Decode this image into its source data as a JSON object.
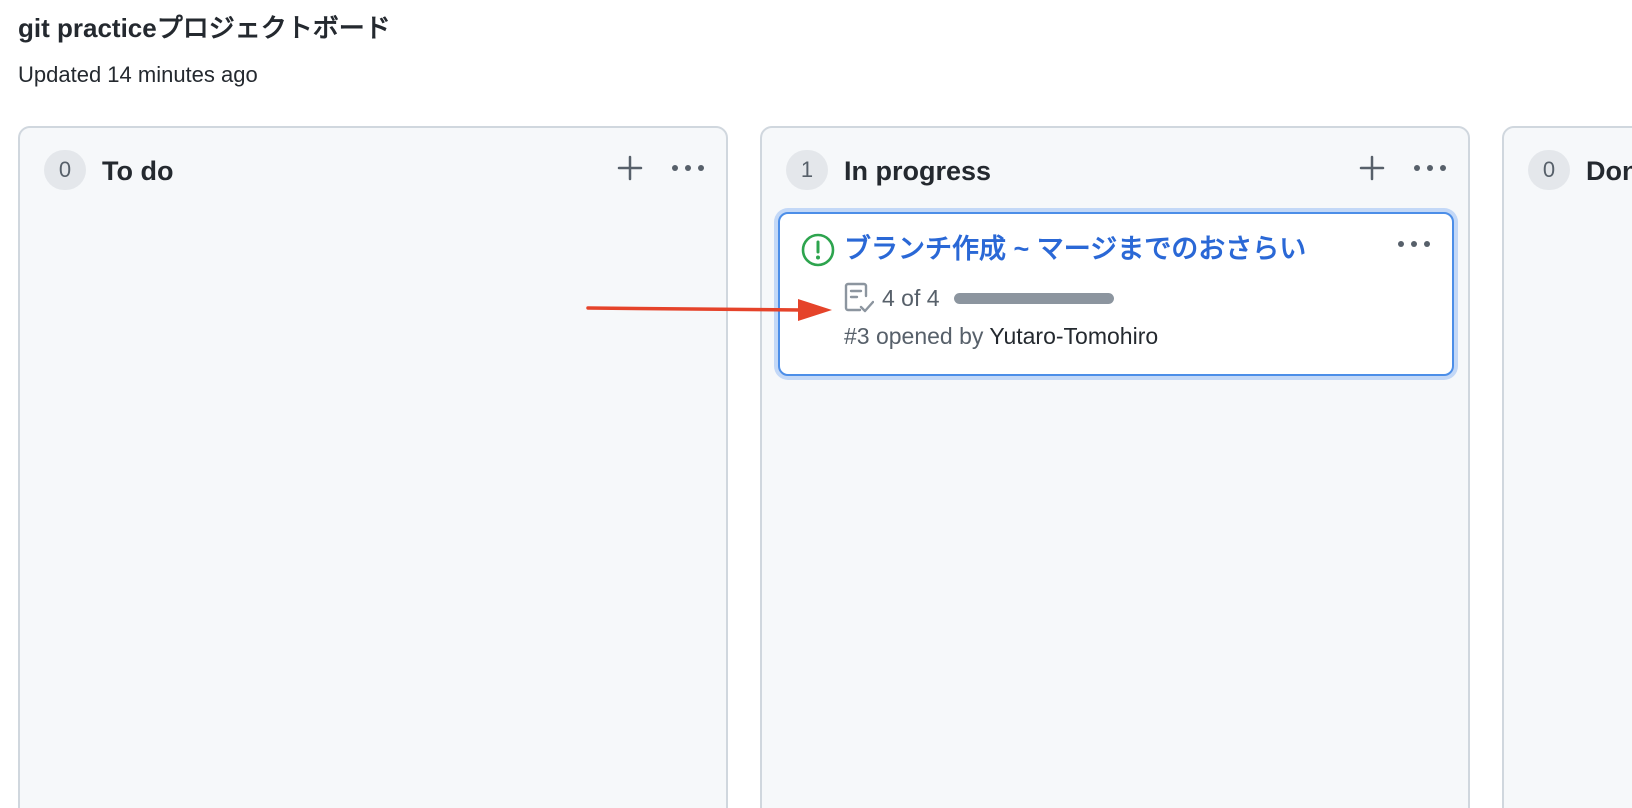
{
  "board": {
    "title": "git practiceプロジェクトボード",
    "updated": "Updated 14 minutes ago"
  },
  "columns": [
    {
      "count": "0",
      "name": "To do"
    },
    {
      "count": "1",
      "name": "In progress"
    },
    {
      "count": "0",
      "name": "Done"
    }
  ],
  "card": {
    "title": "ブランチ作成 ~ マージまでのおさらい",
    "tasks": "4 of 4",
    "progress_fraction": 1.0,
    "meta_prefix": "#3 opened by ",
    "author": "Yutaro-Tomohiro",
    "status": "open"
  },
  "colors": {
    "accent_link": "#2a68d6",
    "open_status": "#2da44e",
    "annotation_arrow": "#e5432a"
  },
  "icons": {
    "add": "plus-icon",
    "menu": "kebab-horizontal-icon",
    "status": "issue-opened-icon",
    "tasks": "checklist-icon"
  }
}
